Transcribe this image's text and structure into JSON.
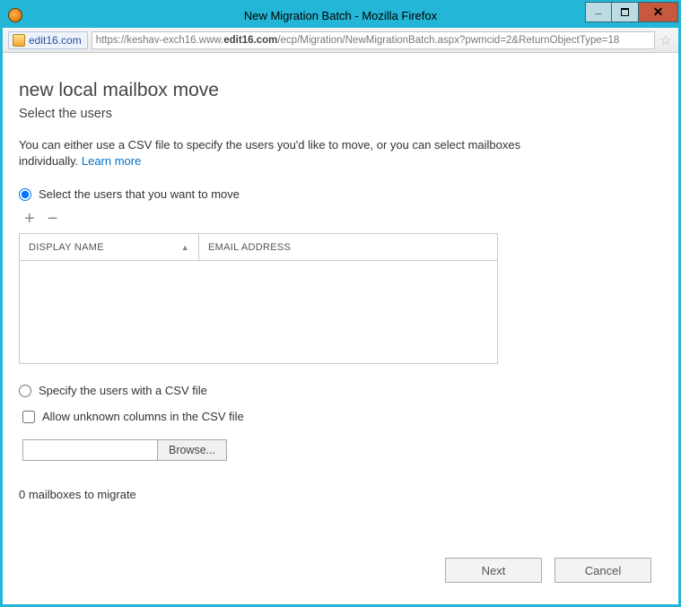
{
  "window": {
    "title": "New Migration Batch - Mozilla Firefox"
  },
  "addressbar": {
    "site_label": "edit16.com",
    "url_pre": "https://keshav-exch16.www.",
    "url_bold": "edit16.com",
    "url_post": "/ecp/Migration/NewMigrationBatch.aspx?pwmcid=2&ReturnObjectType=18"
  },
  "page": {
    "title": "new local mailbox move",
    "subtitle": "Select the users",
    "desc": "You can either use a CSV file to specify the users you'd like to move, or you can select mailboxes individually. ",
    "learn_more": "Learn more"
  },
  "options": {
    "select_users_label": "Select the users that you want to move",
    "csv_label": "Specify the users with a CSV file",
    "allow_unknown_label": "Allow unknown columns in the CSV file"
  },
  "grid": {
    "col_display_name": "DISPLAY NAME",
    "col_email": "EMAIL ADDRESS"
  },
  "browse": {
    "button": "Browse..."
  },
  "status": {
    "text": "0 mailboxes to migrate"
  },
  "footer": {
    "next": "Next",
    "cancel": "Cancel"
  }
}
